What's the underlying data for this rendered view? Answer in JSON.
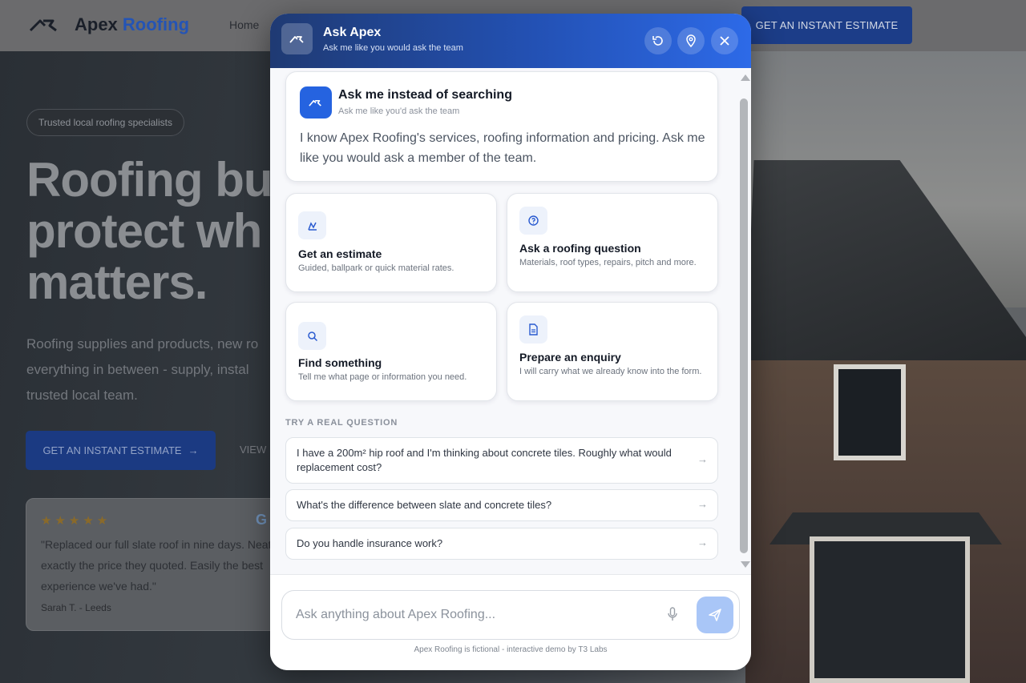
{
  "site": {
    "logo_name": "Apex",
    "logo_accent": "Roofing",
    "nav_home": "Home",
    "cta_top": "GET AN INSTANT ESTIMATE",
    "pill": "Trusted local roofing specialists",
    "headline_1": "Roofing bu",
    "headline_2": "protect wh",
    "headline_3": "matters.",
    "sub_1": "Roofing supplies and products, new ro",
    "sub_2": "everything in between - supply, instal",
    "sub_3": "trusted local team.",
    "cta_hero": "GET AN INSTANT ESTIMATE",
    "cta_hero_arrow": "→",
    "view_link": "VIEW",
    "review": {
      "stars": "★★★★★",
      "g": "G",
      "line_1": "\"Replaced our full slate roof in nine days. Neat",
      "line_2": "exactly the price they quoted. Easily the best",
      "line_3": "experience we've had.\"",
      "author": "Sarah T. - Leeds"
    }
  },
  "widget": {
    "title": "Ask Apex",
    "subtitle": "Ask me like you would ask the team",
    "intro": {
      "title": "Ask me instead of searching",
      "subtitle": "Ask me like you'd ask the team",
      "body": "I know Apex Roofing's services, roofing information and pricing. Ask me like you would ask a member of the team."
    },
    "cards": [
      {
        "title": "Get an estimate",
        "desc": "Guided, ballpark or quick material rates.",
        "icon": "roof-chart-icon"
      },
      {
        "title": "Ask a roofing question",
        "desc": "Materials, roof types, repairs, pitch and more.",
        "icon": "question-bubble-icon"
      },
      {
        "title": "Find something",
        "desc": "Tell me what page or information you need.",
        "icon": "search-icon"
      },
      {
        "title": "Prepare an enquiry",
        "desc": "I will carry what we already know into the form.",
        "icon": "document-icon"
      }
    ],
    "try_label": "TRY A REAL QUESTION",
    "questions": [
      "I have a 200m² hip roof and I'm thinking about concrete tiles. Roughly what would replacement cost?",
      "What's the difference between slate and concrete tiles?",
      "Do you handle insurance work?"
    ],
    "question_arrow": "→",
    "input_placeholder": "Ask anything about Apex Roofing...",
    "footnote": "Apex Roofing is fictional - interactive demo by T3 Labs"
  },
  "colors": {
    "brand_blue": "#2563e0",
    "header_dark": "#1f3a73",
    "send_button": "#a9c6f7"
  }
}
